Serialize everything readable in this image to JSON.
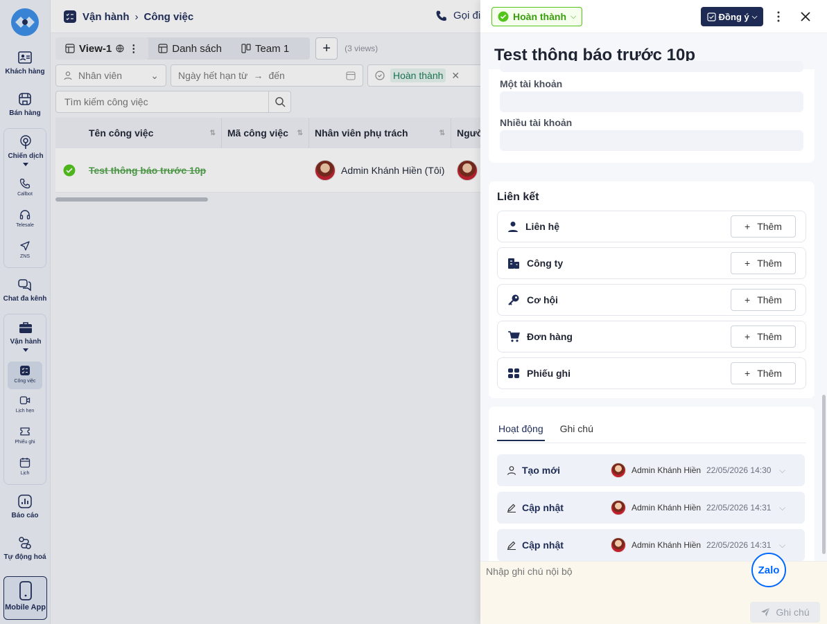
{
  "sidebar": {
    "items": [
      {
        "label": "Khách hàng",
        "icon": "contact-card-icon"
      },
      {
        "label": "Bán hàng",
        "icon": "store-icon"
      },
      {
        "label": "Chiến dịch",
        "icon": "campaign-icon"
      },
      {
        "label": "Chat đa kênh",
        "icon": "chat-icon"
      },
      {
        "label": "Vận hành",
        "icon": "briefcase-icon"
      },
      {
        "label": "Báo cáo",
        "icon": "report-icon"
      },
      {
        "label": "Tự động hoá",
        "icon": "automation-icon"
      },
      {
        "label": "Mobile App",
        "icon": "mobile-icon"
      }
    ],
    "campaign_sub": [
      "Callbot",
      "Telesale",
      "ZNS"
    ],
    "ops_sub": [
      "Công việc",
      "Lịch hẹn",
      "Phiếu ghi",
      "Lịch"
    ]
  },
  "topbar": {
    "section": "Vận hành",
    "page": "Công việc",
    "call": "Gọi điệ"
  },
  "views": {
    "tabs": [
      "View-1",
      "Danh sách",
      "Team 1"
    ],
    "count": "(3 views)"
  },
  "filters": {
    "employee": "Nhân viên",
    "due_from": "Ngày hết hạn từ",
    "due_to": "đến",
    "status_tag": "Hoàn thành",
    "search_placeholder": "Tìm kiếm công việc"
  },
  "table": {
    "columns": [
      "Tên công việc",
      "Mã công việc",
      "Nhân viên phụ trách",
      "Ngườ"
    ],
    "rows": [
      {
        "name": "Test thông báo trước 10p",
        "assignee": "Admin Khánh Hiền (Tôi)"
      }
    ]
  },
  "drawer": {
    "status": "Hoàn thành",
    "agree": "Đồng ý",
    "title": "Test thông báo trước 10p",
    "fields": {
      "single_account": "Một tài khoản",
      "multi_account": "Nhiều tài khoản"
    },
    "links": {
      "title": "Liên kết",
      "add_label": "Thêm",
      "items": [
        "Liên hệ",
        "Công ty",
        "Cơ hội",
        "Đơn hàng",
        "Phiếu ghi"
      ]
    },
    "activity": {
      "tabs": [
        "Hoạt động",
        "Ghi chú"
      ],
      "entries": [
        {
          "action": "Tạo mới",
          "user": "Admin Khánh Hiền",
          "time": "22/05/2026 14:30"
        },
        {
          "action": "Cập nhật",
          "user": "Admin Khánh Hiền",
          "time": "22/05/2026 14:31"
        },
        {
          "action": "Cập nhật",
          "user": "Admin Khánh Hiền",
          "time": "22/05/2026 14:31"
        }
      ]
    },
    "note_placeholder": "Nhập ghi chú nội bộ",
    "send_label": "Ghi chú",
    "zalo": "Zalo"
  }
}
